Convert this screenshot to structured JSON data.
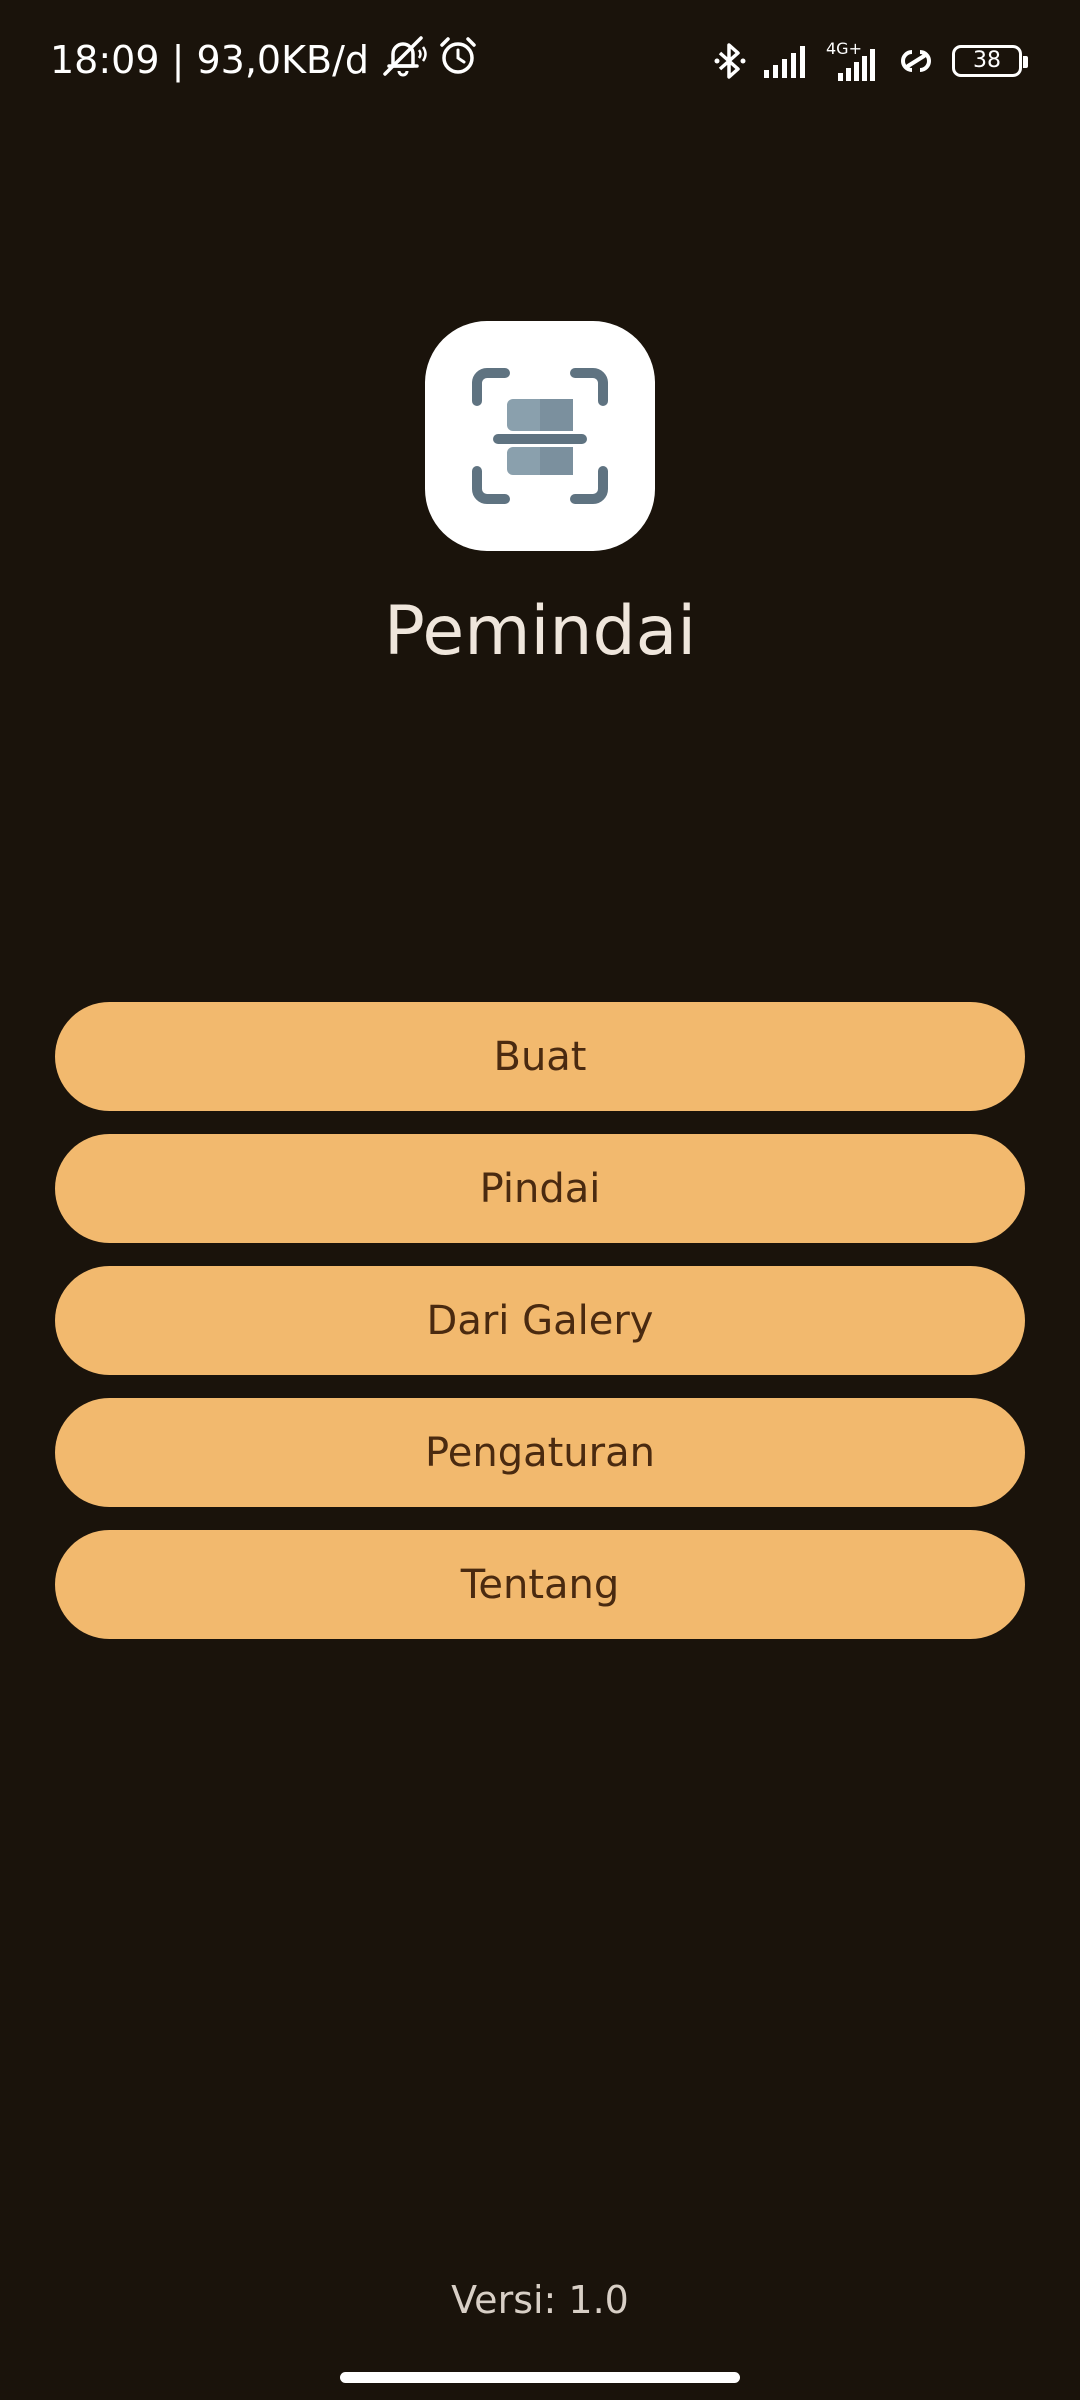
{
  "status_bar": {
    "time_and_speed": "18:09 | 93,0KB/d",
    "network_type": "4G+",
    "battery_level": "38",
    "icons": [
      "muted-bell-icon",
      "alarm-icon",
      "bluetooth-icon",
      "signal-icon",
      "signal-4g-icon",
      "hotspot-link-icon",
      "battery-icon"
    ]
  },
  "app": {
    "icon": "scanner-icon",
    "title": "Pemindai",
    "accent_color": "#f2b96e",
    "background_color": "#1a130b"
  },
  "menu": {
    "buttons": [
      {
        "label": "Buat"
      },
      {
        "label": "Pindai"
      },
      {
        "label": "Dari Galery"
      },
      {
        "label": "Pengaturan"
      },
      {
        "label": "Tentang"
      }
    ]
  },
  "footer": {
    "version": "Versi: 1.0"
  }
}
